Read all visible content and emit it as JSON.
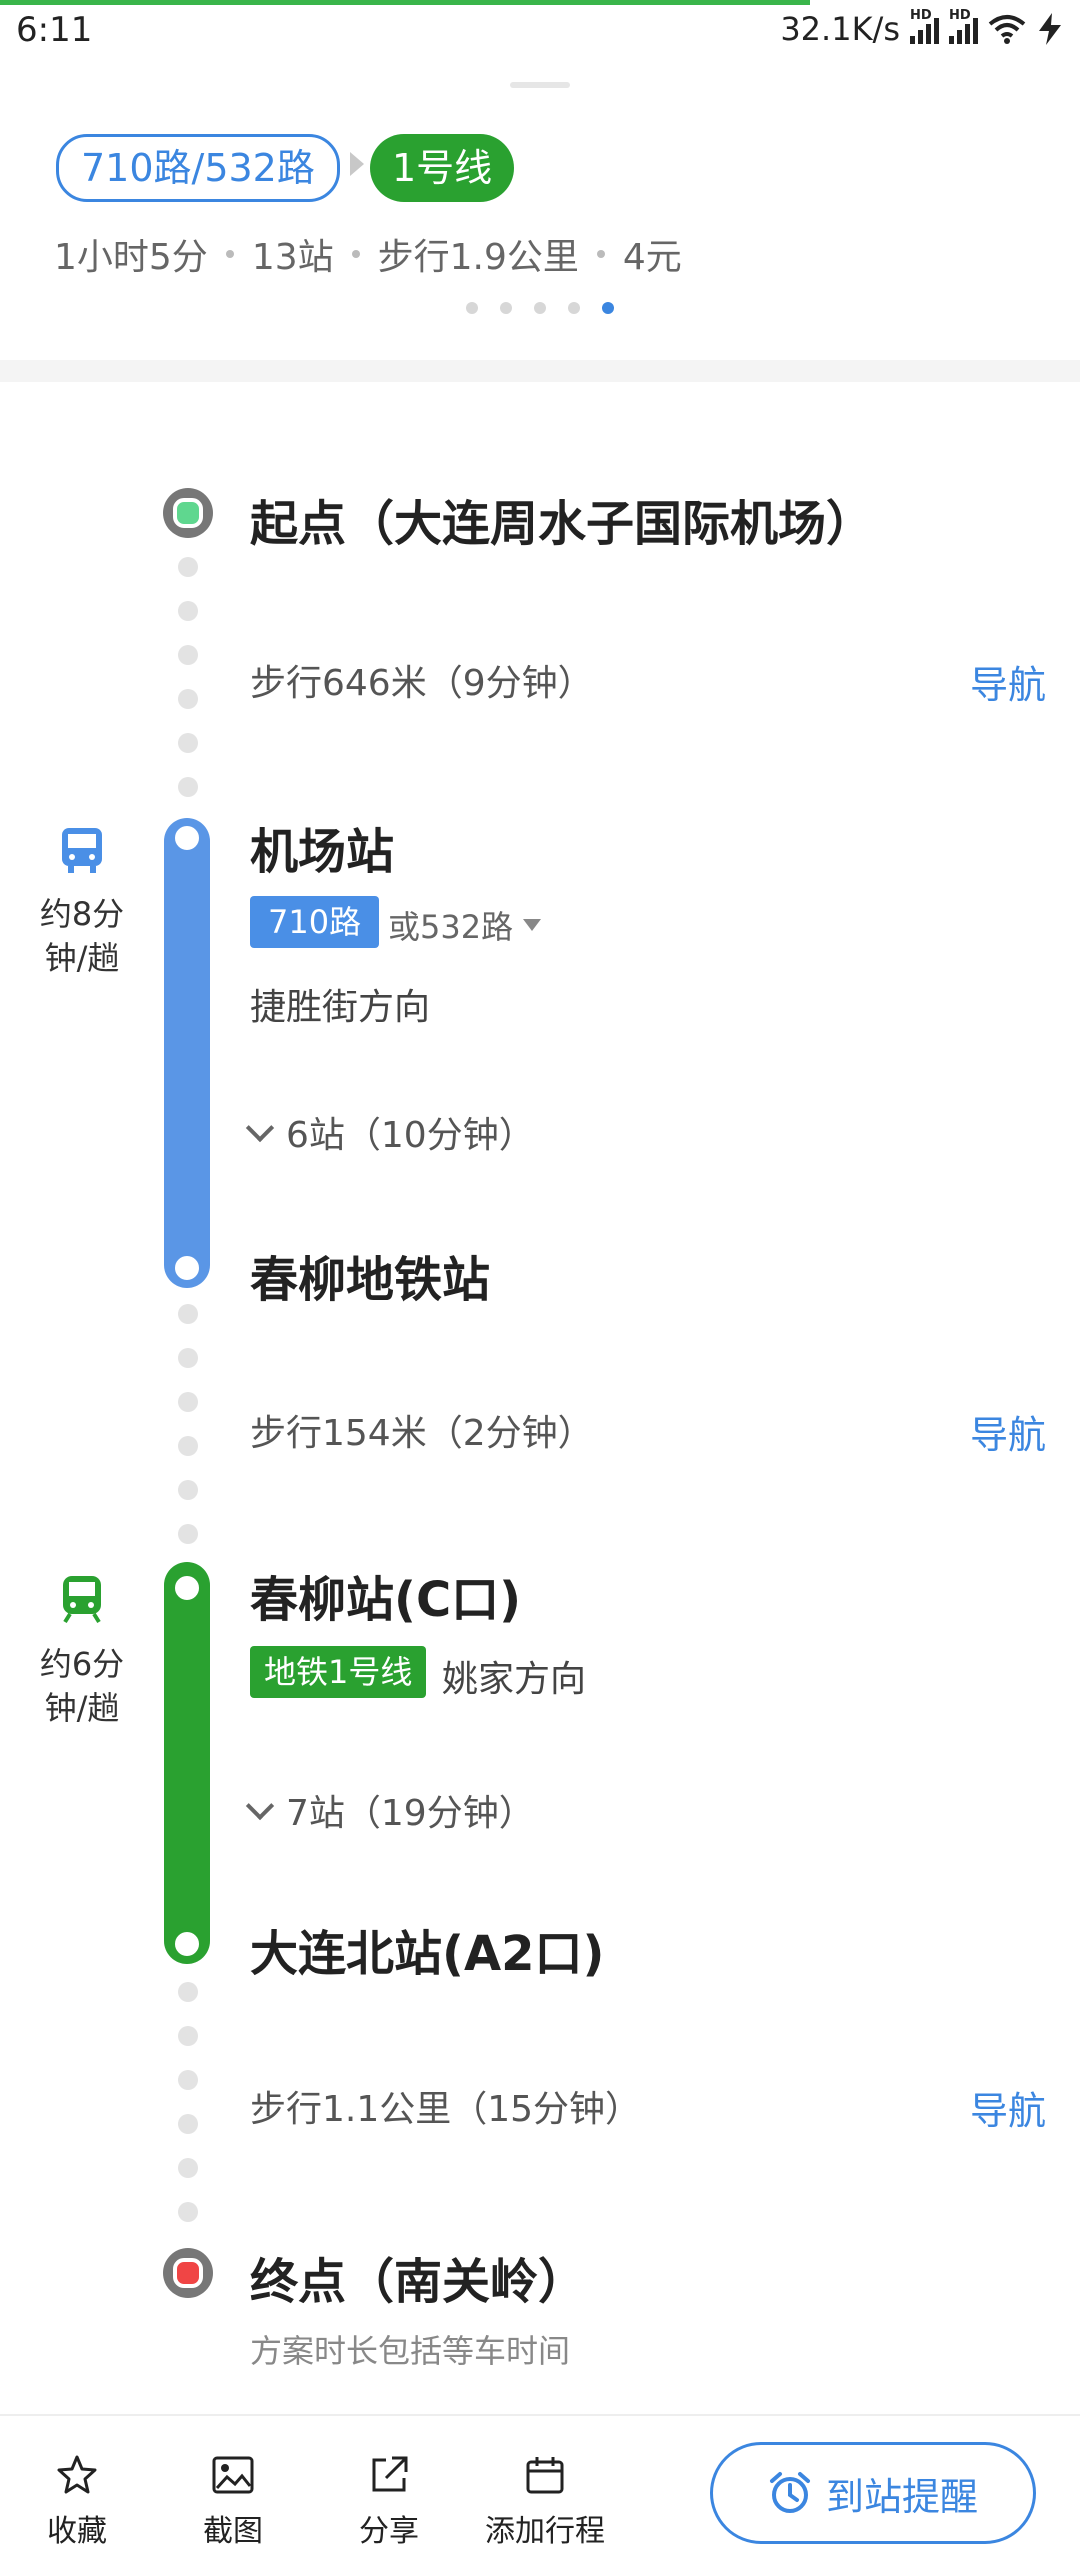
{
  "status_bar": {
    "time": "6:11",
    "net_speed": "32.1K/s",
    "hd1": "HD",
    "hd2": "HD"
  },
  "route": {
    "bus_routes": "710路/532路",
    "metro_line": "1号线",
    "summary": [
      "1小时5分",
      "13站",
      "步行1.9公里",
      "4元"
    ],
    "pager": {
      "count": 5,
      "active": 5
    }
  },
  "timeline": {
    "start": "起点（大连周水子国际机场）",
    "walk1": {
      "text": "步行646米（9分钟）",
      "nav": "导航"
    },
    "bus": {
      "side_time": "约8分钟/趟",
      "board": "机场站",
      "line": "710路",
      "alt": "或532路",
      "direction": "捷胜街方向",
      "stops": "6站（10分钟）",
      "alight": "春柳地铁站"
    },
    "walk2": {
      "text": "步行154米（2分钟）",
      "nav": "导航"
    },
    "subway": {
      "side_time": "约6分钟/趟",
      "board": "春柳站(C口)",
      "line": "地铁1号线",
      "direction": "姚家方向",
      "stops": "7站（19分钟）",
      "alight": "大连北站(A2口)"
    },
    "walk3": {
      "text": "步行1.1公里（15分钟）",
      "nav": "导航"
    },
    "end": "终点（南关岭）",
    "note": "方案时长包括等车时间"
  },
  "toolbar": {
    "favorite": "收藏",
    "screenshot": "截图",
    "share": "分享",
    "add_trip": "添加行程",
    "remind": "到站提醒"
  },
  "colors": {
    "accent_blue": "#3b86e0",
    "bus_blue": "#5a96e6",
    "metro_green": "#2aa130",
    "end_red": "#f04545",
    "start_green": "#5fd78f"
  }
}
